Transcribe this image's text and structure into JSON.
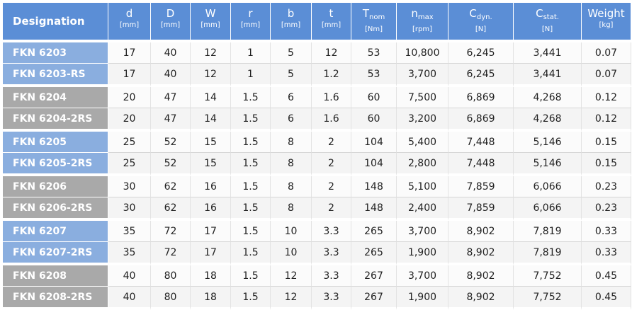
{
  "table": {
    "header": {
      "designation": "Designation",
      "columns": [
        {
          "symbol": "d",
          "sub": "",
          "unit": "[mm]"
        },
        {
          "symbol": "D",
          "sub": "",
          "unit": "[mm]"
        },
        {
          "symbol": "W",
          "sub": "",
          "unit": "[mm]"
        },
        {
          "symbol": "r",
          "sub": "",
          "unit": "[mm]"
        },
        {
          "symbol": "b",
          "sub": "",
          "unit": "[mm]"
        },
        {
          "symbol": "t",
          "sub": "",
          "unit": "[mm]"
        },
        {
          "symbol": "T",
          "sub": "nom",
          "unit": "[Nm]"
        },
        {
          "symbol": "n",
          "sub": "max",
          "unit": "[rpm]"
        },
        {
          "symbol": "C",
          "sub": "dyn.",
          "unit": "[N]"
        },
        {
          "symbol": "C",
          "sub": "stat.",
          "unit": "[N]"
        },
        {
          "symbol": "Weight",
          "sub": "",
          "unit": "[kg]"
        }
      ]
    },
    "colors": {
      "header": "#5b8ed6",
      "group_blue": "#8aaedf",
      "group_gray": "#a9a9a9"
    },
    "rows": [
      {
        "group": "blue",
        "designation": "FKN 6203",
        "values": [
          "17",
          "40",
          "12",
          "1",
          "5",
          "12",
          "53",
          "10,800",
          "6,245",
          "3,441",
          "0.07"
        ]
      },
      {
        "group": "blue",
        "designation": "FKN 6203-RS",
        "values": [
          "17",
          "40",
          "12",
          "1",
          "5",
          "1.2",
          "53",
          "3,700",
          "6,245",
          "3,441",
          "0.07"
        ]
      },
      {
        "group": "gray",
        "designation": "FKN 6204",
        "values": [
          "20",
          "47",
          "14",
          "1.5",
          "6",
          "1.6",
          "60",
          "7,500",
          "6,869",
          "4,268",
          "0.12"
        ]
      },
      {
        "group": "gray",
        "designation": "FKN 6204-2RS",
        "values": [
          "20",
          "47",
          "14",
          "1.5",
          "6",
          "1.6",
          "60",
          "3,200",
          "6,869",
          "4,268",
          "0.12"
        ]
      },
      {
        "group": "blue",
        "designation": "FKN 6205",
        "values": [
          "25",
          "52",
          "15",
          "1.5",
          "8",
          "2",
          "104",
          "5,400",
          "7,448",
          "5,146",
          "0.15"
        ]
      },
      {
        "group": "blue",
        "designation": "FKN 6205-2RS",
        "values": [
          "25",
          "52",
          "15",
          "1.5",
          "8",
          "2",
          "104",
          "2,800",
          "7,448",
          "5,146",
          "0.15"
        ]
      },
      {
        "group": "gray",
        "designation": "FKN 6206",
        "values": [
          "30",
          "62",
          "16",
          "1.5",
          "8",
          "2",
          "148",
          "5,100",
          "7,859",
          "6,066",
          "0.23"
        ]
      },
      {
        "group": "gray",
        "designation": "FKN 6206-2RS",
        "values": [
          "30",
          "62",
          "16",
          "1.5",
          "8",
          "2",
          "148",
          "2,400",
          "7,859",
          "6,066",
          "0.23"
        ]
      },
      {
        "group": "blue",
        "designation": "FKN 6207",
        "values": [
          "35",
          "72",
          "17",
          "1.5",
          "10",
          "3.3",
          "265",
          "3,700",
          "8,902",
          "7,819",
          "0.33"
        ]
      },
      {
        "group": "blue",
        "designation": "FKN 6207-2RS",
        "values": [
          "35",
          "72",
          "17",
          "1.5",
          "10",
          "3.3",
          "265",
          "1,900",
          "8,902",
          "7,819",
          "0.33"
        ]
      },
      {
        "group": "gray",
        "designation": "FKN 6208",
        "values": [
          "40",
          "80",
          "18",
          "1.5",
          "12",
          "3.3",
          "267",
          "3,700",
          "8,902",
          "7,752",
          "0.45"
        ]
      },
      {
        "group": "gray",
        "designation": "FKN 6208-2RS",
        "values": [
          "40",
          "80",
          "18",
          "1.5",
          "12",
          "3.3",
          "267",
          "1,900",
          "8,902",
          "7,752",
          "0.45"
        ]
      }
    ]
  }
}
